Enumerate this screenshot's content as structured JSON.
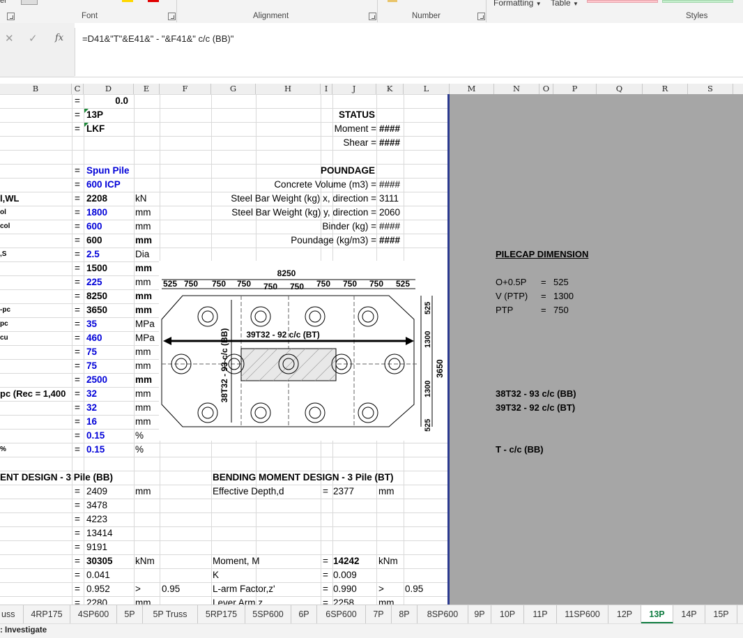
{
  "ribbon": {
    "formatting_label": "Formatting",
    "table_label": "Table",
    "groups": [
      "Font",
      "Alignment",
      "Number",
      "Styles"
    ]
  },
  "formula_bar": {
    "fx": "fx",
    "formula": "=D41&\"T\"&E41&\" - \"&F41&\" c/c (BB)\""
  },
  "columns": [
    "B",
    "C",
    "D",
    "E",
    "F",
    "G",
    "H",
    "I",
    "J",
    "K",
    "L",
    "M",
    "N",
    "O",
    "P",
    "Q",
    "R",
    "S"
  ],
  "left_labels": [
    {
      "text": "l,WL",
      "row": 7
    },
    {
      "text": "ol",
      "row": 8
    },
    {
      "text": "col",
      "row": 9
    },
    {
      "text": ",S",
      "row": 11
    },
    {
      "text": "-pc",
      "row": 15
    },
    {
      "text": "pc",
      "row": 16
    },
    {
      "text": "cu",
      "row": 17
    },
    {
      "text": "pc (Rec = 1,400",
      "row": 21
    },
    {
      "text": " %",
      "row": 25
    }
  ],
  "d_column": [
    {
      "row": 0,
      "eq": "=",
      "val": "0.0",
      "cls": "b r"
    },
    {
      "row": 1,
      "eq": "=",
      "val": "13P",
      "cls": "b"
    },
    {
      "row": 2,
      "eq": "=",
      "val": "LKF",
      "cls": "b"
    },
    {
      "row": 5,
      "eq": "=",
      "val": "Spun Pile",
      "cls": "b blue"
    },
    {
      "row": 6,
      "eq": "=",
      "val": "600 ICP",
      "cls": "b blue"
    },
    {
      "row": 7,
      "eq": "=",
      "val": "2208",
      "cls": "b",
      "unit": "kN"
    },
    {
      "row": 8,
      "eq": "=",
      "val": "1800",
      "cls": "b blue",
      "unit": "mm"
    },
    {
      "row": 9,
      "eq": "=",
      "val": "600",
      "cls": "b blue",
      "unit": "mm"
    },
    {
      "row": 10,
      "eq": "=",
      "val": "600",
      "cls": "b",
      "unit": "mm",
      "ub": true
    },
    {
      "row": 11,
      "eq": "=",
      "val": "2.5",
      "cls": "b blue",
      "unit": "Dia"
    },
    {
      "row": 12,
      "eq": "=",
      "val": "1500",
      "cls": "b",
      "unit": "mm",
      "ub": true
    },
    {
      "row": 13,
      "eq": "=",
      "val": "225",
      "cls": "b blue",
      "unit": "mm"
    },
    {
      "row": 14,
      "eq": "=",
      "val": "8250",
      "cls": "b",
      "unit": "mm",
      "ub": true
    },
    {
      "row": 15,
      "eq": "=",
      "val": "3650",
      "cls": "b",
      "unit": "mm",
      "ub": true
    },
    {
      "row": 16,
      "eq": "=",
      "val": "35",
      "cls": "b blue",
      "unit": "MPa"
    },
    {
      "row": 17,
      "eq": "=",
      "val": "460",
      "cls": "b blue",
      "unit": "MPa"
    },
    {
      "row": 18,
      "eq": "=",
      "val": "75",
      "cls": "b blue",
      "unit": "mm"
    },
    {
      "row": 19,
      "eq": "=",
      "val": "75",
      "cls": "b blue",
      "unit": "mm"
    },
    {
      "row": 20,
      "eq": "=",
      "val": "2500",
      "cls": "b blue",
      "unit": "mm",
      "ub": true
    },
    {
      "row": 21,
      "eq": "=",
      "val": "32",
      "cls": "b blue",
      "unit": "mm"
    },
    {
      "row": 22,
      "eq": "=",
      "val": "32",
      "cls": "b blue",
      "unit": "mm"
    },
    {
      "row": 23,
      "eq": "=",
      "val": "16",
      "cls": "b blue",
      "unit": "mm"
    },
    {
      "row": 24,
      "eq": "=",
      "val": "0.15",
      "cls": "b blue",
      "unit": "%"
    },
    {
      "row": 25,
      "eq": "=",
      "val": "0.15",
      "cls": "b blue",
      "unit": "%"
    }
  ],
  "status_block": {
    "title": "STATUS",
    "moment_label": "Moment =",
    "moment_val": "####",
    "shear_label": "Shear =",
    "shear_val": "####"
  },
  "poundage": {
    "title": "POUNDAGE",
    "rows": [
      {
        "label": "Concrete Volume (m3) =",
        "val": "####",
        "bold": false
      },
      {
        "label": "Steel Bar Weight (kg) x, direction =",
        "val": "3111",
        "bold": false
      },
      {
        "label": "Steel Bar Weight (kg) y, direction =",
        "val": "2060",
        "bold": false
      },
      {
        "label": "Binder (kg) =",
        "val": "####",
        "bold": false
      },
      {
        "label": "Poundage (kg/m3) =",
        "val": "####",
        "bold": true
      }
    ]
  },
  "bm_bb": {
    "title": "ENT DESIGN - 3 Pile (BB)",
    "rows": [
      {
        "val": "2409",
        "unit": "mm"
      },
      {
        "val": "3478",
        "unit": ""
      },
      {
        "val": "4223",
        "unit": ""
      },
      {
        "val": "13414",
        "unit": ""
      },
      {
        "val": "9191",
        "unit": ""
      },
      {
        "val": "30305",
        "unit": "kNm",
        "bold": true
      },
      {
        "val": "0.041",
        "unit": ""
      },
      {
        "val": "0.952",
        "unit": ">",
        "extra": "0.95"
      },
      {
        "val": "2280",
        "unit": "mm"
      }
    ]
  },
  "bm_bt": {
    "title": "BENDING MOMENT DESIGN - 3 Pile (BT)",
    "rows": [
      {
        "label": "Effective Depth,d",
        "val": "2377",
        "unit": "mm",
        "row": 28
      },
      {
        "label": "Moment, M",
        "val": "14242",
        "unit": "kNm",
        "row": 33,
        "bold": true
      },
      {
        "label": "K",
        "val": "0.009",
        "unit": "",
        "row": 34
      },
      {
        "label": "L-arm Factor,z'",
        "val": "0.990",
        "unit": ">",
        "row": 35,
        "extra": "0.95"
      },
      {
        "label": "Lever Arm,z",
        "val": "2258",
        "unit": "mm",
        "row": 36
      }
    ]
  },
  "drawing": {
    "top_dim": "8250",
    "spacings": [
      "525",
      "750",
      "750",
      "750",
      "750",
      "750",
      "750",
      "750",
      "750",
      "750",
      "525"
    ],
    "right_dims": [
      "525",
      "1300",
      "1300",
      "525"
    ],
    "right_total": "3650",
    "bt_label": "39T32 - 92 c/c (BT)",
    "bb_label": "38T32 - 93 c/c (BB)"
  },
  "pilecap": {
    "title": "PILECAP DIMENSION",
    "rows": [
      {
        "k": "O+0.5P",
        "eq": "=",
        "v": "525"
      },
      {
        "k": "V (PTP)",
        "eq": "=",
        "v": "1300"
      },
      {
        "k": "PTP",
        "eq": "=",
        "v": "750"
      }
    ],
    "bb": "38T32 - 93 c/c (BB)",
    "bt": "39T32 - 92 c/c (BT)",
    "t_cc": "T -  c/c (BB)"
  },
  "tabs": [
    "uss",
    "4RP175",
    "4SP600",
    "5P",
    "5P Truss",
    "5RP175",
    "5SP600",
    "6P",
    "6SP600",
    "7P",
    "8P",
    "8SP600",
    "9P",
    "10P",
    "11P",
    "11SP600",
    "12P",
    "13P",
    "14P",
    "15P"
  ],
  "active_tab": "13P",
  "status_text": ": Investigate"
}
